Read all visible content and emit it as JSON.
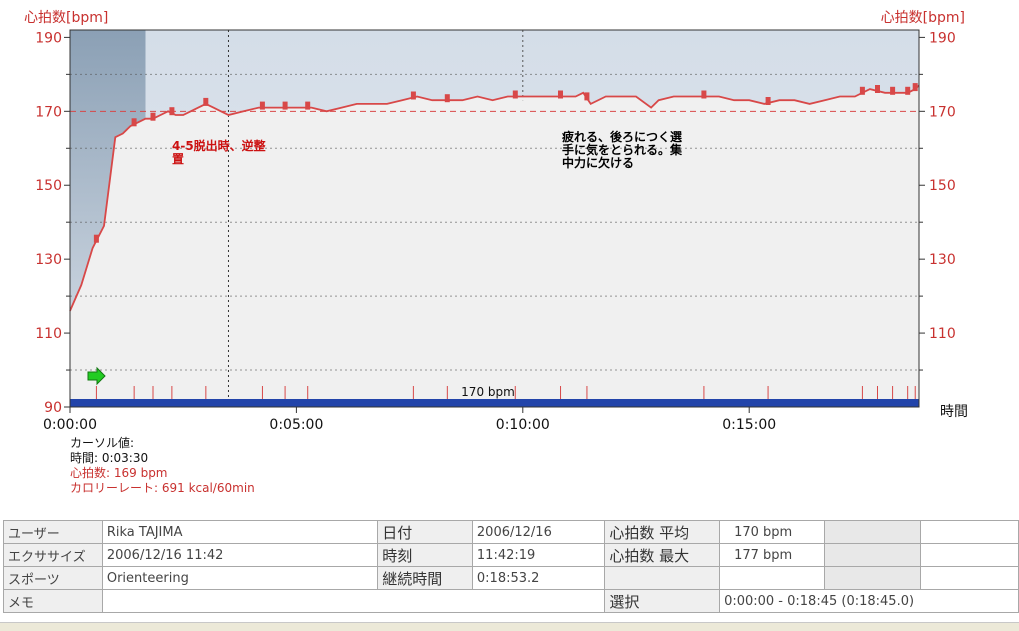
{
  "chart_data": {
    "type": "line",
    "title": "",
    "y_axis_label_left": "心拍数[bpm]",
    "y_axis_label_right": "心拍数[bpm]",
    "x_axis_label": "時間",
    "ylim": [
      90,
      192
    ],
    "xlim_seconds": [
      0,
      1125
    ],
    "y_ticks": [
      "190",
      "170",
      "150",
      "130",
      "110",
      "90"
    ],
    "y_ticks_right": [
      "190",
      "170",
      "150",
      "130",
      "110"
    ],
    "x_ticks": [
      "0:00:00",
      "0:05:00",
      "0:10:00",
      "0:15:00"
    ],
    "target_line": {
      "value": 170,
      "label": "170 bpm"
    },
    "cursor": {
      "time": "0:03:30"
    },
    "series": [
      {
        "color": "#d84848",
        "x": [
          "0:00:00",
          "0:00:15",
          "0:00:30",
          "0:00:45",
          "0:01:00",
          "0:01:10",
          "0:01:20",
          "0:01:30",
          "0:01:40",
          "0:01:50",
          "0:02:00",
          "0:02:10",
          "0:02:20",
          "0:02:30",
          "0:02:40",
          "0:02:50",
          "0:03:00",
          "0:03:10",
          "0:03:20",
          "0:03:30",
          "0:03:50",
          "0:04:10",
          "0:04:30",
          "0:04:50",
          "0:05:10",
          "0:05:20",
          "0:05:40",
          "0:06:00",
          "0:06:20",
          "0:06:40",
          "0:07:00",
          "0:07:20",
          "0:07:40",
          "0:08:00",
          "0:08:20",
          "0:08:40",
          "0:09:00",
          "0:09:20",
          "0:09:40",
          "0:10:00",
          "0:10:20",
          "0:10:40",
          "0:11:00",
          "0:11:10",
          "0:11:20",
          "0:11:30",
          "0:11:50",
          "0:12:10",
          "0:12:30",
          "0:12:50",
          "0:13:00",
          "0:13:20",
          "0:13:40",
          "0:14:00",
          "0:14:20",
          "0:14:40",
          "0:15:00",
          "0:15:20",
          "0:15:40",
          "0:16:00",
          "0:16:20",
          "0:16:40",
          "0:17:00",
          "0:17:20",
          "0:17:40",
          "0:18:00",
          "0:18:20",
          "0:18:30",
          "0:18:40",
          "0:18:45"
        ],
        "y": [
          116,
          123,
          133,
          139,
          163,
          164,
          166,
          167,
          168,
          168,
          169,
          170,
          169,
          169,
          170,
          171,
          172,
          171,
          170,
          169,
          170,
          171,
          171,
          171,
          171,
          171,
          170,
          171,
          172,
          172,
          172,
          173,
          174,
          173,
          173,
          173,
          174,
          173,
          174,
          174,
          174,
          174,
          174,
          174,
          175,
          172,
          174,
          174,
          174,
          171,
          173,
          174,
          174,
          174,
          174,
          173,
          173,
          172,
          173,
          173,
          172,
          173,
          174,
          174,
          176,
          175,
          175,
          175,
          176,
          177
        ]
      }
    ],
    "markers_x": [
      "0:00:35",
      "0:01:25",
      "0:01:50",
      "0:02:15",
      "0:03:00",
      "0:04:15",
      "0:04:45",
      "0:05:15",
      "0:07:35",
      "0:08:20",
      "0:09:50",
      "0:10:50",
      "0:11:25",
      "0:14:00",
      "0:15:25",
      "0:17:30",
      "0:17:50",
      "0:18:10",
      "0:18:30",
      "0:18:40"
    ],
    "annotations": [
      {
        "lines": [
          "4-5脱出時、逆整",
          "置"
        ],
        "color": "#cc1111"
      },
      {
        "lines": [
          "疲れる、後ろにつく選",
          "手に気をとられる。集",
          "中力に欠ける"
        ],
        "color": "#000000"
      }
    ],
    "colors": {
      "line": "#d84848",
      "bar": "#2244aa",
      "lap_tick": "#d84848",
      "plot_bg": "#f0f0f0",
      "above_bg_top": "#d8e0ea",
      "below_bg": "#a8b8c8"
    }
  },
  "cursor_info": {
    "title": "カーソル値:",
    "time": "時間: 0:03:30",
    "hr": "心拍数: 169  bpm",
    "calorie": "カロリーレート: 691  kcal/60min"
  },
  "info_table": {
    "user_label": "ユーザー",
    "user_value": "Rika TAJIMA",
    "date_label": "日付",
    "date_value": "2006/12/16",
    "hr_avg_label": "心拍数 平均",
    "hr_avg_value": "170 bpm",
    "exercise_label": "エクササイズ",
    "exercise_value": "2006/12/16 11:42",
    "time_label": "時刻",
    "time_value": "11:42:19",
    "hr_max_label": "心拍数 最大",
    "hr_max_value": "177 bpm",
    "sport_label": "スポーツ",
    "sport_value": "Orienteering",
    "duration_label": "継続時間",
    "duration_value": "0:18:53.2",
    "memo_label": "メモ",
    "selection_label": "選択",
    "selection_value": "0:00:00 - 0:18:45 (0:18:45.0)"
  }
}
